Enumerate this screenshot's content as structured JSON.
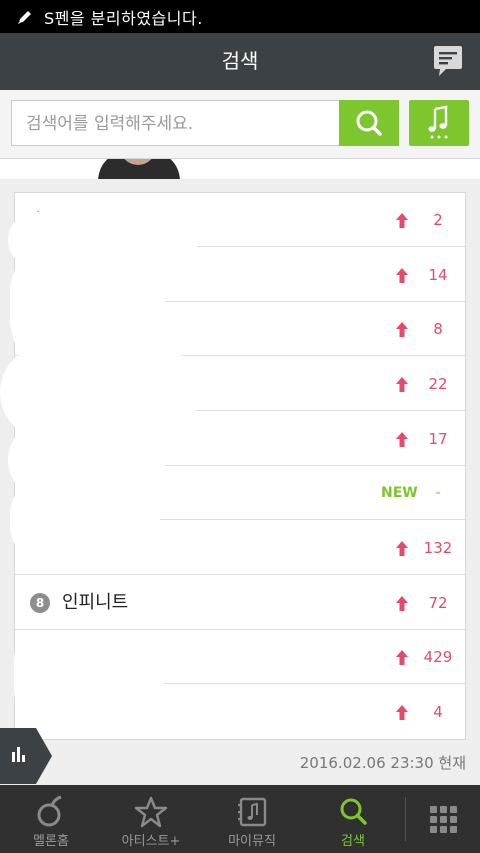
{
  "status_bar": {
    "text": "S펜을 분리하였습니다."
  },
  "header": {
    "title": "검색"
  },
  "search": {
    "placeholder": "검색어를 입력해주세요."
  },
  "chart": {
    "rows": [
      {
        "rank": "",
        "name": "",
        "trend": "up",
        "change": "2"
      },
      {
        "rank": "",
        "name": "",
        "trend": "up",
        "change": "14"
      },
      {
        "rank": "",
        "name": "",
        "trend": "up",
        "change": "8"
      },
      {
        "rank": "",
        "name": "",
        "trend": "up",
        "change": "22"
      },
      {
        "rank": "",
        "name": "",
        "trend": "up",
        "change": "17"
      },
      {
        "rank": "",
        "name": "",
        "trend": "new",
        "badge": "NEW",
        "change": "-"
      },
      {
        "rank": "",
        "name": "",
        "trend": "up",
        "change": "132"
      },
      {
        "rank": "8",
        "name": "인피니트",
        "trend": "up",
        "change": "72"
      },
      {
        "rank": "",
        "name": "",
        "trend": "up",
        "change": "429"
      },
      {
        "rank": "",
        "name": "",
        "trend": "up",
        "change": "4"
      }
    ],
    "timestamp": "2016.02.06 23:30 현재"
  },
  "bottom_nav": [
    {
      "label": "멜론홈",
      "icon": "melon-home-icon"
    },
    {
      "label": "아티스트+",
      "icon": "star-icon"
    },
    {
      "label": "마이뮤직",
      "icon": "my-music-icon"
    },
    {
      "label": "검색",
      "icon": "search-icon"
    },
    {
      "label": "",
      "icon": "grid-menu-icon"
    }
  ],
  "colors": {
    "accent": "#7ec62e",
    "header": "#3b4145",
    "rise": "#e24c6a"
  }
}
